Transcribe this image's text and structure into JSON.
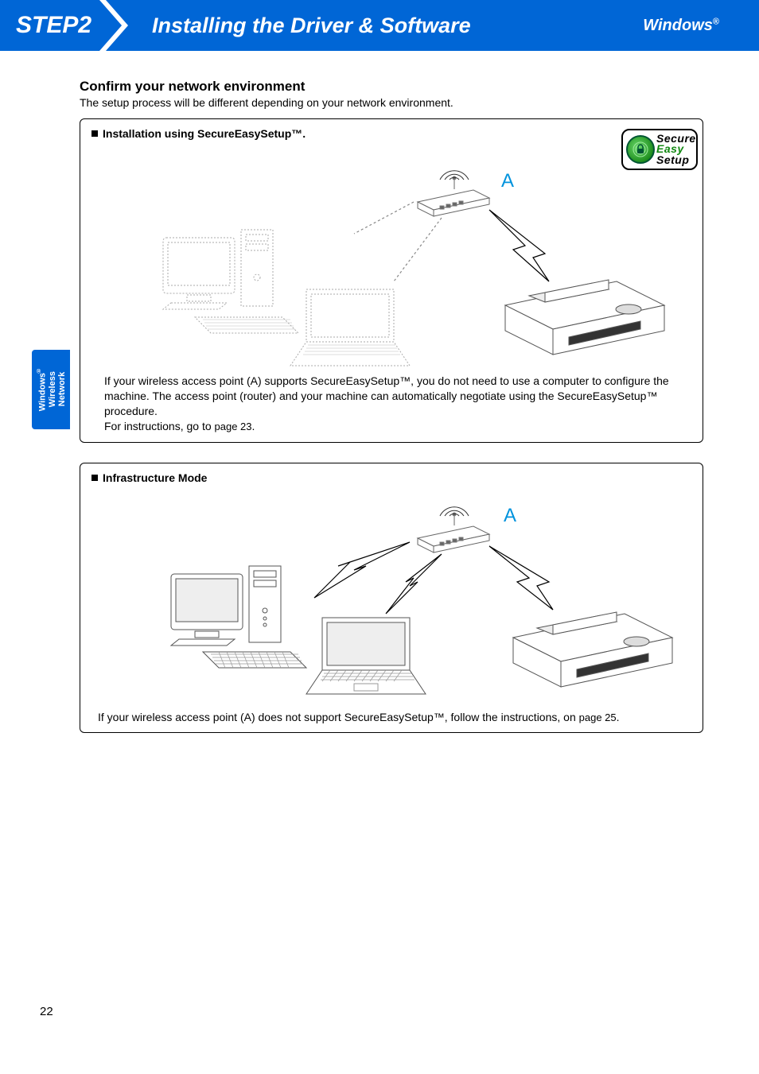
{
  "header": {
    "step": "STEP2",
    "title": "Installing the Driver & Software",
    "os": "Windows",
    "os_reg": "®"
  },
  "side_tab": {
    "line1": "Windows",
    "line1_reg": "®",
    "line2": "Wireless",
    "line3": "Network"
  },
  "section": {
    "heading": "Confirm your network environment",
    "subtext": "The setup process will be different depending on your network environment."
  },
  "box1": {
    "title": "Installation using SecureEasySetup™.",
    "router_label": "A",
    "badge": {
      "l1": "Secure",
      "l2": "Easy",
      "l3": "Setup"
    },
    "text": "If your wireless access point (A) supports SecureEasySetup™, you do not need to use a computer to configure the machine. The access point (router) and your machine can automatically negotiate using the SecureEasySetup™ procedure.",
    "instructions_prefix": "For instructions, go to ",
    "page_ref": "page 23",
    "period": "."
  },
  "box2": {
    "title": "Infrastructure Mode",
    "router_label": "A",
    "text_prefix": "If your wireless access point (A) does not support SecureEasySetup™, follow the instructions, on ",
    "page_ref": "page 25",
    "period": "."
  },
  "page_number": "22"
}
